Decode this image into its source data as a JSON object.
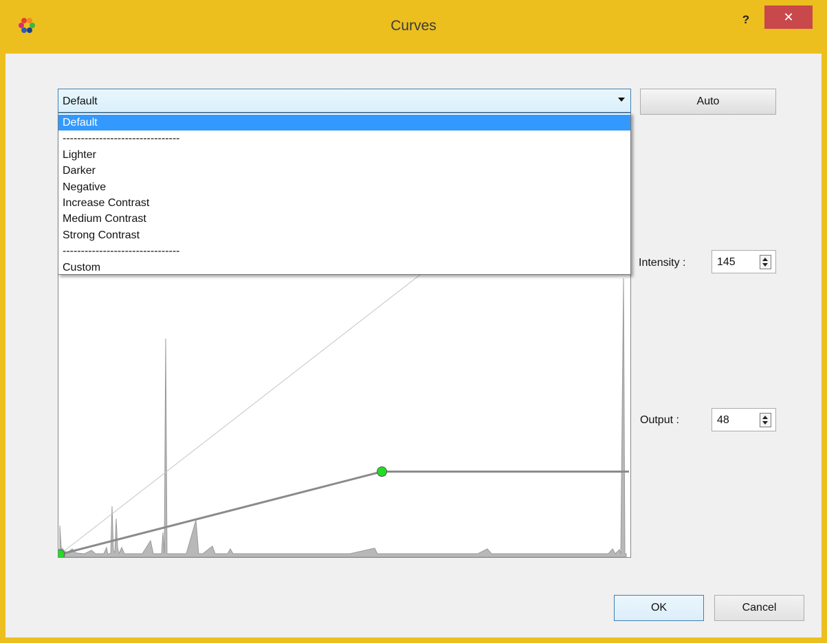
{
  "window": {
    "title": "Curves",
    "help_label": "?",
    "close_label": "✕",
    "accent_color": "#ecbf1e",
    "close_color": "#c9484c"
  },
  "preset": {
    "selected": "Default",
    "options": [
      "Default",
      "--------------------------------",
      "Lighter",
      "Darker",
      "Negative",
      "Increase Contrast",
      "Medium Contrast",
      "Strong Contrast",
      "--------------------------------",
      "Custom"
    ],
    "highlighted_index": 0
  },
  "auto_button": {
    "label": "Auto"
  },
  "intensity": {
    "label": "Intensity :",
    "value": "145"
  },
  "output": {
    "label": "Output :",
    "value": "48"
  },
  "curve": {
    "range": [
      0,
      255
    ],
    "control_points": [
      {
        "in": 0,
        "out": 0
      },
      {
        "in": 145,
        "out": 48
      }
    ],
    "point_color": "#22dd22"
  },
  "buttons": {
    "ok": "OK",
    "cancel": "Cancel"
  }
}
